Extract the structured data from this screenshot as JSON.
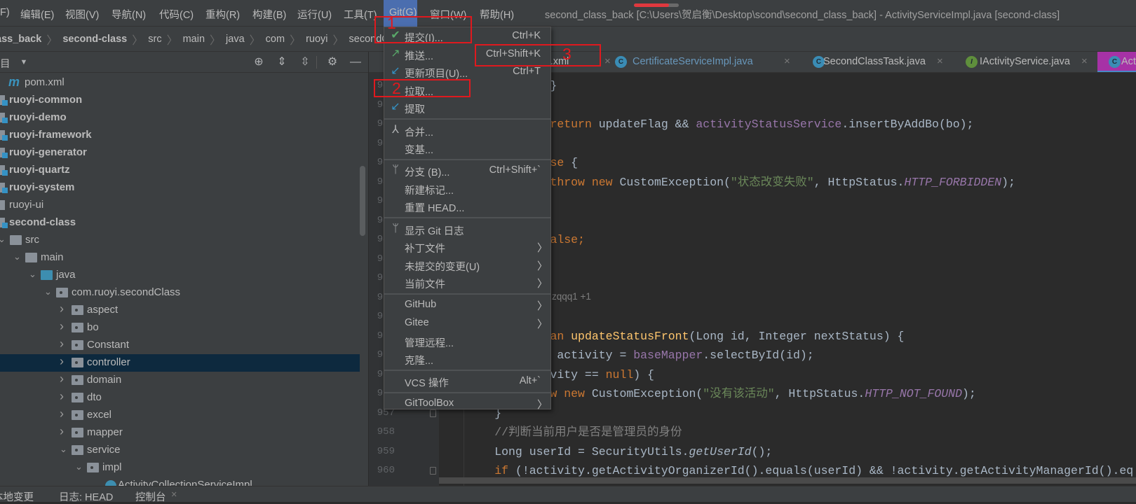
{
  "colors": {
    "accent": "#4b6eaf",
    "annotation": "#e0191e",
    "selection": "#0d293e",
    "active_tab": "#a632a6"
  },
  "menubar": {
    "items": [
      "F)",
      "编辑(E)",
      "视图(V)",
      "导航(N)",
      "代码(C)",
      "重构(R)",
      "构建(B)",
      "运行(U)",
      "工具(T)",
      "Git(G)",
      "窗口(W)",
      "帮助(H)"
    ],
    "title": "second_class_back [C:\\Users\\贺启衡\\Desktop\\scond\\second_class_back] - ActivityServiceImpl.java [second-class]",
    "progress": 0.78
  },
  "breadcrumb": [
    {
      "label": "ass_back",
      "bold": true
    },
    {
      "label": "second-class",
      "bold": true
    },
    {
      "label": "src"
    },
    {
      "label": "main"
    },
    {
      "label": "java"
    },
    {
      "label": "com"
    },
    {
      "label": "ruoyi"
    },
    {
      "label": "secondClass"
    }
  ],
  "project_toolbar": {
    "title": "目",
    "icons": [
      "dropdown-icon",
      "locate-icon",
      "expand-all-icon",
      "collapse-all-icon",
      "gear-icon",
      "minimize-icon"
    ]
  },
  "tree": [
    {
      "label": "pom.xml",
      "type": "maven",
      "depth": 0
    },
    {
      "label": "ruoyi-common",
      "type": "module",
      "bold": true
    },
    {
      "label": "ruoyi-demo",
      "type": "module",
      "bold": true
    },
    {
      "label": "ruoyi-framework",
      "type": "module",
      "bold": true
    },
    {
      "label": "ruoyi-generator",
      "type": "module",
      "bold": true
    },
    {
      "label": "ruoyi-quartz",
      "type": "module",
      "bold": true
    },
    {
      "label": "ruoyi-system",
      "type": "module",
      "bold": true
    },
    {
      "label": "ruoyi-ui",
      "type": "plain-module"
    },
    {
      "label": "second-class",
      "type": "module",
      "bold": true
    },
    {
      "label": "src",
      "type": "folder",
      "depth": 0,
      "expanded": true
    },
    {
      "label": "main",
      "type": "folder",
      "depth": 1,
      "expanded": true
    },
    {
      "label": "java",
      "type": "source",
      "depth": 2,
      "expanded": true
    },
    {
      "label": "com.ruoyi.secondClass",
      "type": "package",
      "depth": 3,
      "expanded": true
    },
    {
      "label": "aspect",
      "type": "package",
      "depth": 4
    },
    {
      "label": "bo",
      "type": "package",
      "depth": 4
    },
    {
      "label": "Constant",
      "type": "package",
      "depth": 4
    },
    {
      "label": "controller",
      "type": "package",
      "depth": 4,
      "selected": true
    },
    {
      "label": "domain",
      "type": "package",
      "depth": 4
    },
    {
      "label": "dto",
      "type": "package",
      "depth": 4
    },
    {
      "label": "excel",
      "type": "package",
      "depth": 4
    },
    {
      "label": "mapper",
      "type": "package",
      "depth": 4
    },
    {
      "label": "service",
      "type": "package",
      "depth": 4,
      "expanded": true
    },
    {
      "label": "impl",
      "type": "package",
      "depth": 5,
      "expanded": true
    },
    {
      "label": "ActivityCollectionServiceImpl",
      "type": "class",
      "depth": 6
    }
  ],
  "tabs": [
    {
      "label": "gback.xml",
      "icon": "xml-icon"
    },
    {
      "label": "CertificateServiceImpl.java",
      "icon": "C",
      "color": "#6897bb"
    },
    {
      "label": "SecondClassTask.java",
      "icon": "C"
    },
    {
      "label": "IActivityService.java",
      "icon": "I"
    },
    {
      "label": "Act",
      "icon": "C",
      "active": true
    }
  ],
  "editor": {
    "author_hint": "zqqq1 +1",
    "lines": [
      {
        "n": 940,
        "t": [
          [
            "                }",
            "p"
          ]
        ]
      },
      {
        "n": 941,
        "t": []
      },
      {
        "n": 942,
        "t": [
          [
            "                ",
            "p"
          ],
          [
            "return",
            "k"
          ],
          [
            " updateFlag && ",
            "p"
          ],
          [
            "activityStatusService",
            "f"
          ],
          [
            ".insertByAddBo(bo);",
            "p"
          ]
        ]
      },
      {
        "n": 943,
        "t": []
      },
      {
        "n": 944,
        "t": [
          [
            "                ",
            "p"
          ],
          [
            "se",
            "k"
          ],
          [
            " {",
            "p"
          ]
        ]
      },
      {
        "n": 945,
        "t": [
          [
            "                ",
            "p"
          ],
          [
            "throw",
            "k"
          ],
          [
            " ",
            "p"
          ],
          [
            "new",
            "k"
          ],
          [
            " CustomException(",
            "p"
          ],
          [
            "\"状态改变失败\"",
            "s"
          ],
          [
            ", HttpStatus.",
            "p"
          ],
          [
            "HTTP_FORBIDDEN",
            "fi"
          ],
          [
            ");",
            "p"
          ]
        ]
      },
      {
        "n": 946,
        "t": []
      },
      {
        "n": 947,
        "t": []
      },
      {
        "n": 948,
        "t": [
          [
            "                ",
            "p"
          ],
          [
            "alse;",
            "k"
          ]
        ]
      },
      {
        "n": 949,
        "t": []
      },
      {
        "n": 950,
        "t": []
      },
      {
        "n": 951,
        "t": []
      },
      {
        "n": 952,
        "t": []
      },
      {
        "n": 953,
        "t": [
          [
            "                ",
            "p"
          ],
          [
            "an",
            "k"
          ],
          [
            " ",
            "p"
          ],
          [
            "updateStatusFront",
            "m"
          ],
          [
            "(Long id, Integer nextStatus) {",
            "p"
          ]
        ]
      },
      {
        "n": 954,
        "t": [
          [
            "                 activity = ",
            "p"
          ],
          [
            "baseMapper",
            "f"
          ],
          [
            ".selectById(id);",
            "p"
          ]
        ]
      },
      {
        "n": 955,
        "t": [
          [
            "                vity == ",
            "p"
          ],
          [
            "null",
            "k"
          ],
          [
            ") {",
            "p"
          ]
        ]
      },
      {
        "n": 956,
        "t": [
          [
            "                ",
            "p"
          ],
          [
            "w",
            "k"
          ],
          [
            " ",
            "p"
          ],
          [
            "new",
            "k"
          ],
          [
            " CustomException(",
            "p"
          ],
          [
            "\"没有该活动\"",
            "s"
          ],
          [
            ", HttpStatus.",
            "p"
          ],
          [
            "HTTP_NOT_FOUND",
            "fi"
          ],
          [
            ");",
            "p"
          ]
        ]
      },
      {
        "n": 957,
        "t": [
          [
            "        }",
            "p"
          ]
        ]
      },
      {
        "n": 958,
        "t": [
          [
            "        //判断当前用户是否是管理员的身份",
            "c"
          ]
        ]
      },
      {
        "n": 959,
        "t": [
          [
            "        Long userId = SecurityUtils.",
            "p"
          ],
          [
            "getUserId",
            "i"
          ],
          [
            "();",
            "p"
          ]
        ]
      },
      {
        "n": 960,
        "t": [
          [
            "        ",
            "p"
          ],
          [
            "if",
            "k"
          ],
          [
            " (!activity.getActivityOrganizerId().equals(userId) && !activity.getActivityManagerId().eq",
            "p"
          ]
        ]
      }
    ]
  },
  "git_menu": {
    "items": [
      {
        "label": "提交(I)...",
        "shortcut": "Ctrl+K",
        "icon": "check-icon"
      },
      {
        "label": "推送...",
        "shortcut": "Ctrl+Shift+K",
        "icon": "push-icon"
      },
      {
        "label": "更新项目(U)...",
        "shortcut": "Ctrl+T",
        "icon": "update-icon"
      },
      {
        "label": "拉取...",
        "icon": ""
      },
      {
        "label": "提取",
        "icon": "fetch-icon"
      },
      {
        "sep": true
      },
      {
        "label": "合并...",
        "icon": "merge-icon"
      },
      {
        "label": "变基...",
        "icon": ""
      },
      {
        "sep": true
      },
      {
        "label": "分支 (B)...",
        "shortcut": "Ctrl+Shift+`",
        "icon": "branch-icon"
      },
      {
        "label": "新建标记...",
        "icon": ""
      },
      {
        "label": "重置 HEAD...",
        "icon": ""
      },
      {
        "sep": true
      },
      {
        "label": "显示 Git 日志",
        "icon": "git-log-icon"
      },
      {
        "label": "补丁文件",
        "submenu": true
      },
      {
        "label": "未提交的变更(U)",
        "submenu": true
      },
      {
        "label": "当前文件",
        "submenu": true
      },
      {
        "sep": true
      },
      {
        "label": "GitHub",
        "submenu": true
      },
      {
        "label": "Gitee",
        "submenu": true
      },
      {
        "label": "管理远程..."
      },
      {
        "label": "克隆..."
      },
      {
        "sep": true
      },
      {
        "label": "VCS 操作",
        "shortcut": "Alt+`"
      },
      {
        "sep": true
      },
      {
        "label": "GitToolBox",
        "submenu": true
      }
    ]
  },
  "annotations": [
    "1",
    "2",
    "3"
  ],
  "bottom_tabs": [
    "本地变更",
    "日志: HEAD",
    "控制台"
  ]
}
